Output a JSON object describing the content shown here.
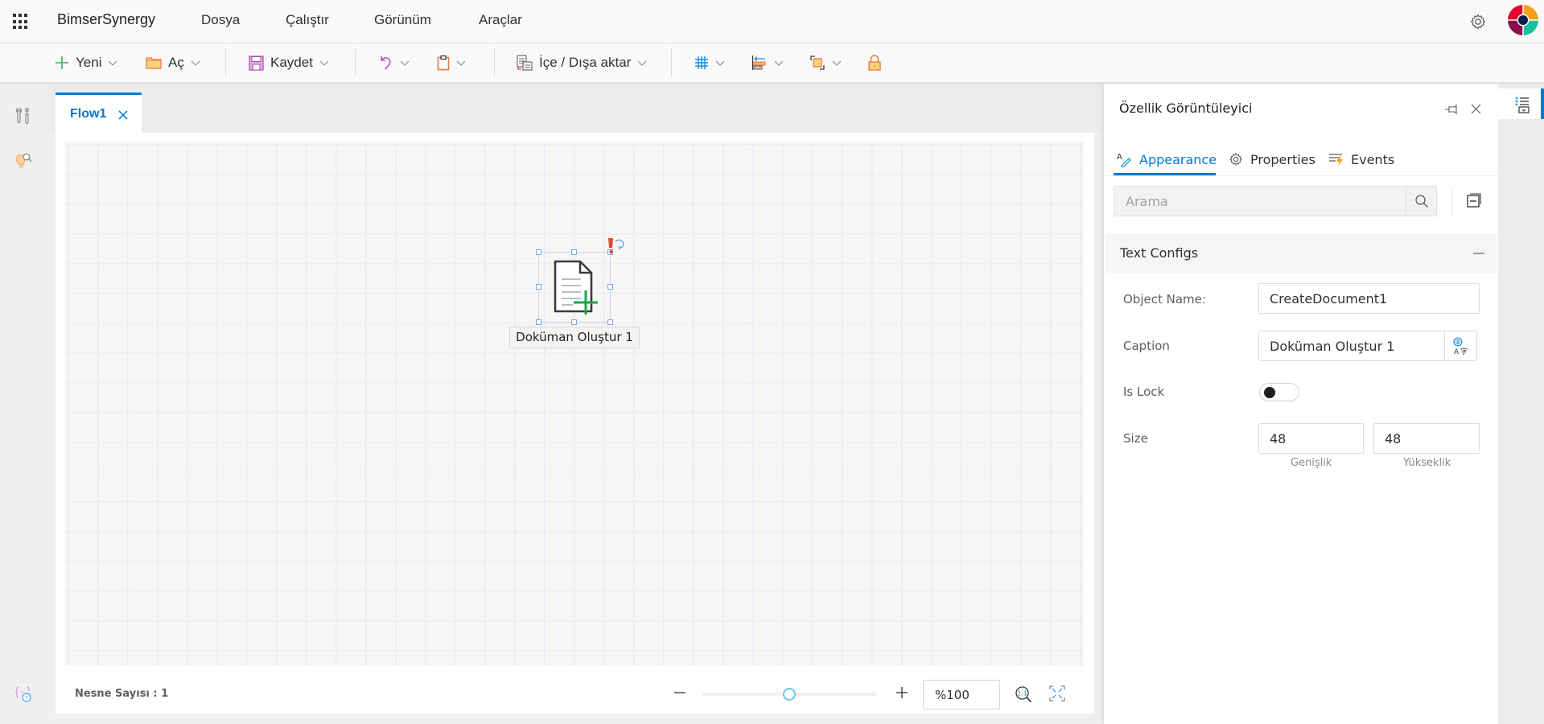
{
  "app": {
    "brand": "BimserSynergy",
    "menu": [
      "Dosya",
      "Çalıştır",
      "Görünüm",
      "Araçlar"
    ],
    "icons": {
      "launcher": "waffle-icon",
      "settings": "gear-icon",
      "avatar": "company-logo-avatar"
    },
    "logo_colors": [
      "#e4002b",
      "#f7a01b",
      "#8b0d4a",
      "#18bfa0",
      "#0b1c48"
    ]
  },
  "toolbar": {
    "new_label": "Yeni",
    "open_label": "Aç",
    "save_label": "Kaydet",
    "undo_icon": "undo-icon",
    "paste_icon": "clipboard-icon",
    "import_export_label": "İçe / Dışa aktar",
    "grid_icon": "grid-icon",
    "align_icon": "align-left-icon",
    "arrange_icon": "bring-front-icon",
    "lock_icon": "lock-icon"
  },
  "left_rail": {
    "items": [
      {
        "name": "tools",
        "icon": "wrench-screwdriver-icon"
      },
      {
        "name": "insights",
        "icon": "lightbulb-search-icon"
      },
      {
        "name": "variables-help",
        "icon": "braces-help-icon"
      }
    ]
  },
  "editor": {
    "tab": {
      "label": "Flow1"
    },
    "node": {
      "caption": "Doküman Oluştur 1",
      "icon": "create-document-icon",
      "status": "warning"
    },
    "footer": {
      "object_count_label": "Nesne Sayısı : 1",
      "zoom_value": "%100",
      "zoom_slider_fraction": 0.5
    }
  },
  "property_panel": {
    "title": "Özellik Görüntüleyici",
    "tabs": [
      {
        "label": "Appearance",
        "active": true
      },
      {
        "label": "Properties",
        "active": false
      },
      {
        "label": "Events",
        "active": false
      }
    ],
    "search_placeholder": "Arama",
    "section": {
      "title": "Text Configs",
      "fields": {
        "object_name_label": "Object Name:",
        "object_name_value": "CreateDocument1",
        "caption_label": "Caption",
        "caption_value": "Doküman Oluştur 1",
        "is_lock_label": "Is Lock",
        "is_lock_value": false,
        "size_label": "Size",
        "width_value": "48",
        "height_value": "48",
        "width_sub": "Genişlik",
        "height_sub": "Yükseklik"
      }
    }
  },
  "colors": {
    "accent": "#0078d4"
  }
}
